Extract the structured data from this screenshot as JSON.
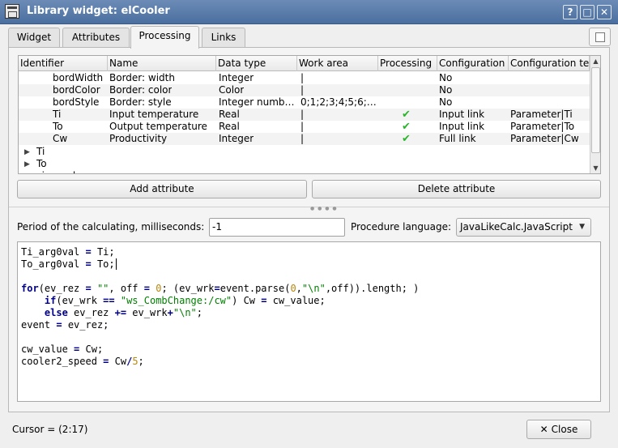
{
  "window": {
    "title": "Library widget: elCooler",
    "controls": {
      "help": "?",
      "maximize": "□",
      "minimize_alt": "▣",
      "close": "✕"
    }
  },
  "tabs": [
    {
      "label": "Widget"
    },
    {
      "label": "Attributes"
    },
    {
      "label": "Processing",
      "active": true
    },
    {
      "label": "Links"
    }
  ],
  "table": {
    "headers": [
      "Identifier",
      "Name",
      "Data type",
      "Work area",
      "Processing",
      "Configuration",
      "Configuration te"
    ],
    "rows": [
      {
        "id": "bordWidth",
        "name": "Border: width",
        "type": "Integer",
        "work": "|",
        "proc": "",
        "conf": "No",
        "conft": ""
      },
      {
        "id": "bordColor",
        "name": "Border: color",
        "type": "Color",
        "work": "|",
        "proc": "",
        "conf": "No",
        "conft": ""
      },
      {
        "id": "bordStyle",
        "name": "Border: style",
        "type": "Integer numb…",
        "work": "0;1;2;3;4;5;6;…",
        "proc": "",
        "conf": "No",
        "conft": ""
      },
      {
        "id": "Ti",
        "name": "Input temperature",
        "type": "Real",
        "work": "|",
        "proc": "✔",
        "conf": "Input link",
        "conft": "Parameter|Ti"
      },
      {
        "id": "To",
        "name": "Output temperature",
        "type": "Real",
        "work": "|",
        "proc": "✔",
        "conf": "Input link",
        "conft": "Parameter|To"
      },
      {
        "id": "Cw",
        "name": "Productivity",
        "type": "Integer",
        "work": "|",
        "proc": "✔",
        "conf": "Full link",
        "conft": "Parameter|Cw"
      }
    ],
    "tree_items": [
      "Ti",
      "To",
      "cip_cooler"
    ]
  },
  "buttons": {
    "add_attribute": "Add attribute",
    "delete_attribute": "Delete attribute",
    "close": "Close"
  },
  "period": {
    "label": "Period of the calculating, milliseconds:",
    "value": "-1"
  },
  "procedure": {
    "label": "Procedure language:",
    "value": "JavaLikeCalc.JavaScript"
  },
  "code": {
    "lines": [
      "Ti_arg0val = Ti;",
      "To_arg0val = To;",
      "",
      "for(ev_rez = \"\", off = 0; (ev_wrk=event.parse(0,\"\\n\",off)).length; )",
      "    if(ev_wrk == \"ws_CombChange:/cw\") Cw = cw_value;",
      "    else ev_rez += ev_wrk+\"\\n\";",
      "event = ev_rez;",
      "",
      "cw_value = Cw;",
      "cooler2_speed = Cw/5;"
    ]
  },
  "status": {
    "cursor": "Cursor = (2:17)"
  },
  "icons": {
    "app": "library-widget-icon",
    "check": "check-icon",
    "expand": "expand-arrow-icon"
  }
}
